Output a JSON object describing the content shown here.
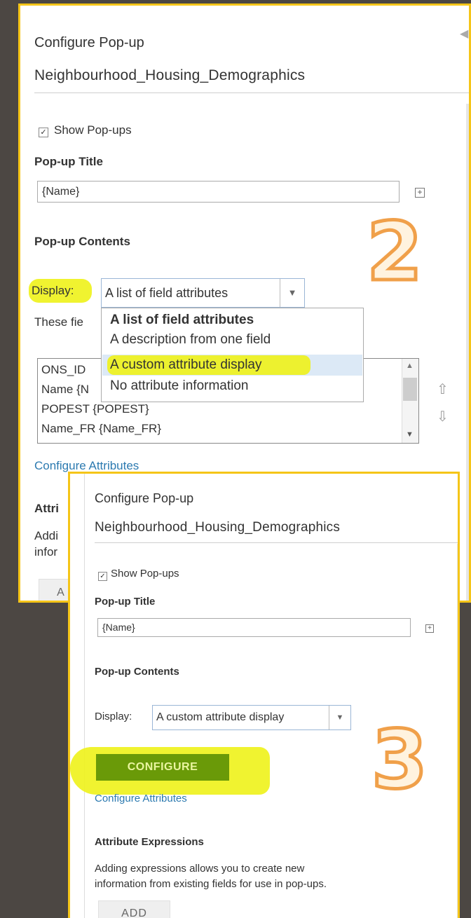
{
  "panel1": {
    "title": "Configure Pop-up",
    "layer_name": "Neighbourhood_Housing_Demographics",
    "show_popups_label": "Show Pop-ups",
    "show_popups_checked": true,
    "popup_title_heading": "Pop-up Title",
    "popup_title_value": "{Name}",
    "popup_contents_heading": "Pop-up Contents",
    "display_label": "Display",
    "display_colon": ":",
    "display_selected": "A list of field attributes",
    "dropdown_options": [
      "A list of field attributes",
      "A description from one field",
      "A custom attribute display",
      "No attribute information"
    ],
    "these_fields_partial": "These fie",
    "field_list": [
      "ONS_ID",
      "Name {N",
      "POPEST {POPEST}",
      "Name_FR {Name_FR}"
    ],
    "configure_attributes_link": "Configure Attributes",
    "attr_expr_partial": "Attri",
    "adding_partial": "Addi",
    "info_partial": "infor",
    "add_partial": "A"
  },
  "panel2": {
    "title": "Configure Pop-up",
    "layer_name": "Neighbourhood_Housing_Demographics",
    "show_popups_label": "Show Pop-ups",
    "show_popups_checked": true,
    "popup_title_heading": "Pop-up Title",
    "popup_title_value": "{Name}",
    "popup_contents_heading": "Pop-up Contents",
    "display_label": "Display:",
    "display_selected": "A custom attribute display",
    "configure_button": "CONFIGURE",
    "configure_attributes_link": "Configure Attributes",
    "attr_expr_heading": "Attribute Expressions",
    "attr_expr_desc_line1": "Adding expressions allows you to create new",
    "attr_expr_desc_line2": "information from existing fields for use in pop-ups.",
    "add_button": "ADD"
  },
  "annotations": {
    "step2": "2",
    "step3": "3",
    "highlight_color": "#eef21a",
    "number_color": "#f0a04a"
  },
  "icons": {
    "checkbox": "check-icon",
    "add_field": "plus-square-icon",
    "dropdown": "chevron-down-icon",
    "move_up": "arrow-up-icon",
    "move_down": "arrow-down-icon",
    "collapse": "chevron-left-icon"
  },
  "colors": {
    "background": "#4c4743",
    "panel_border": "#f5c518",
    "link": "#2c7ab0",
    "configure_button": "#6a9a08"
  }
}
